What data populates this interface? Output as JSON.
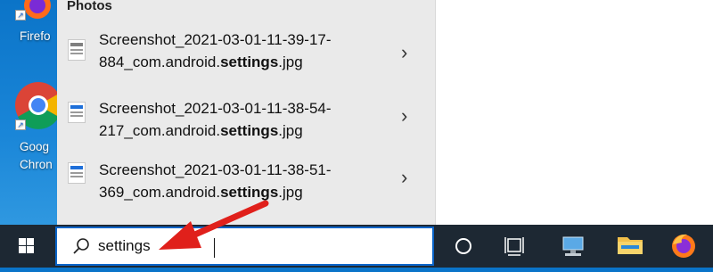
{
  "desktop": {
    "icons": [
      {
        "label_lines": [
          "Firefo"
        ]
      },
      {
        "label_lines": [
          "Goog",
          "Chron"
        ]
      }
    ]
  },
  "search_panel": {
    "section_title": "Photos",
    "results": [
      {
        "line1": "Screenshot_2021-03-01-11-39-17-",
        "line2_prefix": "884_com.android.",
        "line2_bold": "settings",
        "line2_suffix": ".jpg"
      },
      {
        "line1": "Screenshot_2021-03-01-11-38-54-",
        "line2_prefix": "217_com.android.",
        "line2_bold": "settings",
        "line2_suffix": ".jpg"
      },
      {
        "line1": "Screenshot_2021-03-01-11-38-51-",
        "line2_prefix": "369_com.android.",
        "line2_bold": "settings",
        "line2_suffix": ".jpg"
      }
    ]
  },
  "taskbar": {
    "search_value": "settings",
    "icons": [
      "windows-start-icon",
      "search-icon",
      "cortana-icon",
      "task-view-icon",
      "computer-icon",
      "file-explorer-icon",
      "firefox-icon"
    ]
  },
  "colors": {
    "accent": "#0a64c8",
    "arrow": "#e0201b",
    "taskbar": "#1d2833"
  }
}
